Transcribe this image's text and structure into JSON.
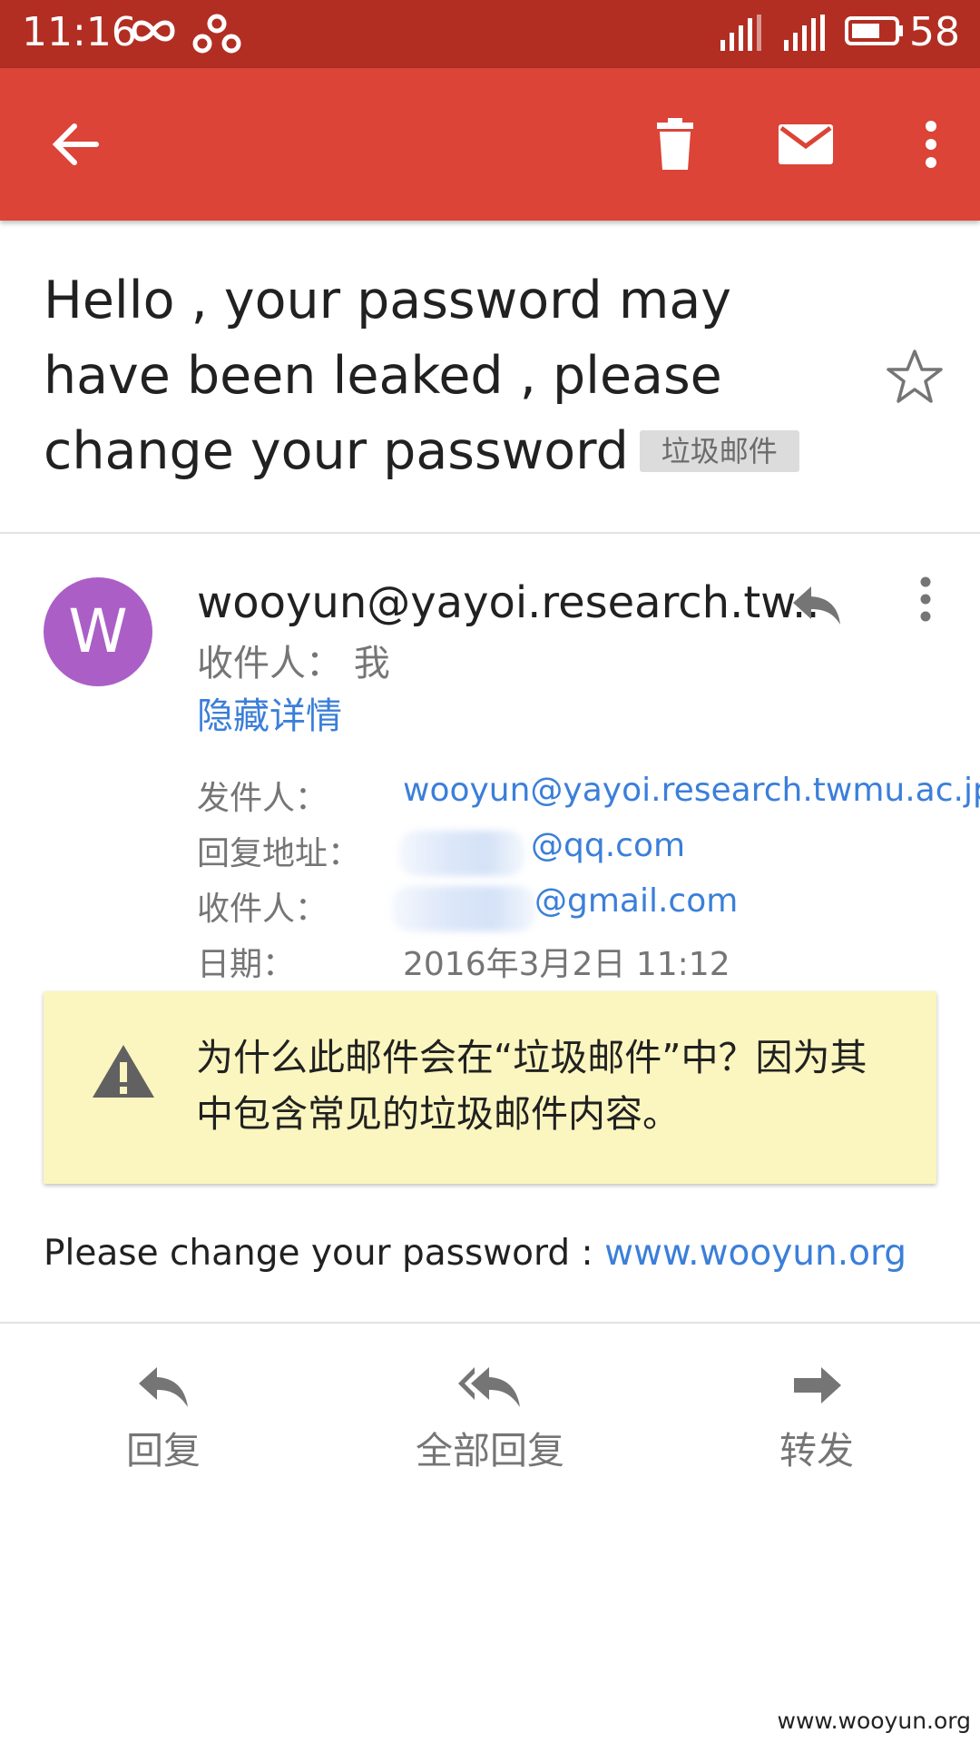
{
  "status_bar": {
    "time": "11:16",
    "battery": "58",
    "icons": [
      "infinity-icon",
      "link-icon",
      "signal-hplus-icon",
      "signal-icon",
      "battery-icon"
    ]
  },
  "toolbar": {
    "icons": [
      "back-arrow-icon",
      "trash-icon",
      "mail-icon",
      "overflow-menu-icon"
    ]
  },
  "email": {
    "subject": "Hello , your password may have been leaked , please change your password",
    "spam_tag": "垃圾邮件",
    "avatar_letter": "W",
    "sender_short": "wooyun@yayoi.research.tw..",
    "to_summary": "收件人： 我",
    "hide_details": "隐藏详情",
    "details": [
      {
        "label": "发件人：",
        "value": "wooyun@yayoi.research.twmu.ac.jp",
        "redacted": false
      },
      {
        "label": "回复地址：",
        "value": "@qq.com",
        "redacted": true
      },
      {
        "label": "收件人：",
        "value": "@gmail.com",
        "redacted": true
      },
      {
        "label": "日期：",
        "value": "2016年3月2日 11:12",
        "redacted": false
      }
    ],
    "warning": "为什么此邮件会在“垃圾邮件”中？因为其中包含常见的垃圾邮件内容。",
    "body_prefix": "Please change your password : ",
    "body_link": "www.wooyun.org"
  },
  "actions": {
    "reply": "回复",
    "reply_all": "全部回复",
    "forward": "转发"
  },
  "watermark": "www.wooyun.org",
  "colors": {
    "status_bar": "#b22e22",
    "app_bar": "#db4437",
    "avatar": "#ab5fc6",
    "link": "#3b7fd9",
    "warning_bg": "#fbf6bf"
  }
}
